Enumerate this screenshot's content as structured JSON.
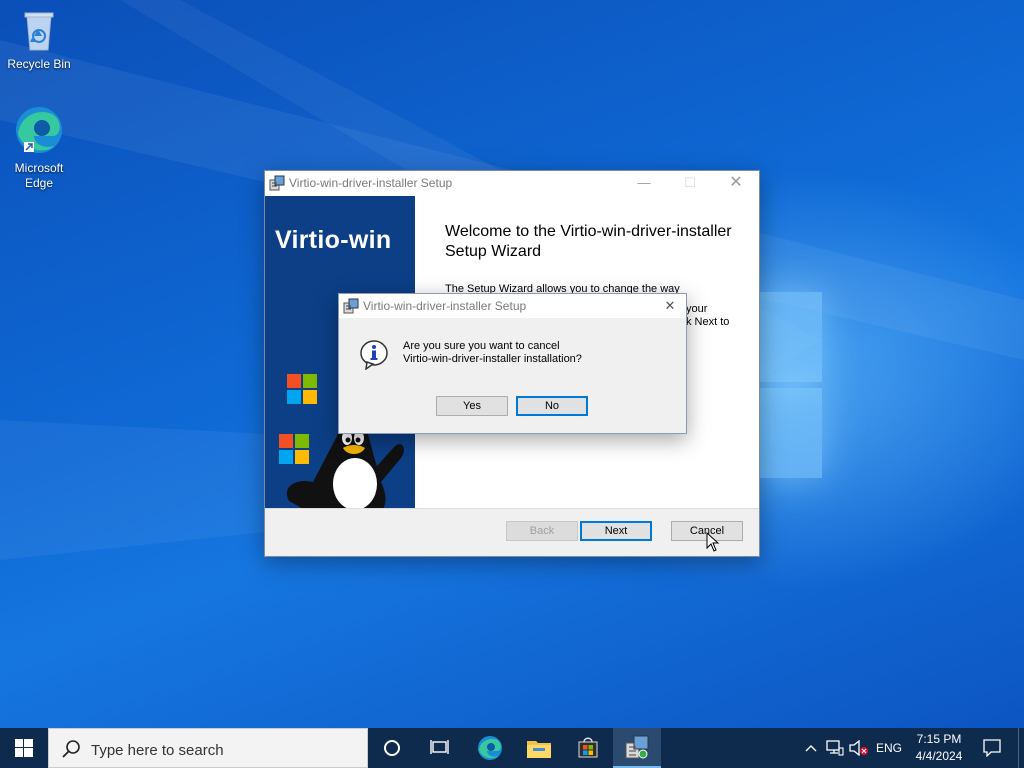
{
  "desktop": {
    "icons": [
      {
        "label": "Recycle Bin",
        "icon": "recycle-bin-icon"
      },
      {
        "label": "Microsoft Edge",
        "icon": "edge-icon"
      }
    ]
  },
  "setup_window": {
    "title": "Virtio-win-driver-installer Setup",
    "banner_title": "Virtio-win",
    "welcome_heading": "Welcome to the Virtio-win-driver-installer Setup Wizard",
    "body_partial_1": "The Setup Wizard allows you to change the way",
    "body_partial_2": "your",
    "body_partial_3": "k Next to",
    "buttons": {
      "back": "Back",
      "next": "Next",
      "cancel": "Cancel"
    },
    "back_enabled": false
  },
  "confirm_dialog": {
    "title": "Virtio-win-driver-installer Setup",
    "message_line1": "Are you sure you want to cancel",
    "message_line2": "Virtio-win-driver-installer installation?",
    "buttons": {
      "yes": "Yes",
      "no": "No"
    }
  },
  "taskbar": {
    "search_placeholder": "Type here to search",
    "language": "ENG",
    "time": "7:15 PM",
    "date": "4/4/2024",
    "items": [
      "start-icon",
      "cortana-icon",
      "task-view-icon",
      "edge-icon",
      "file-explorer-icon",
      "store-icon",
      "setup-icon"
    ]
  },
  "colors": {
    "accent": "#0078d7",
    "banner": "#0c3f86",
    "taskbar": "#0e2a4d",
    "desktop": "#0f6ad6"
  }
}
